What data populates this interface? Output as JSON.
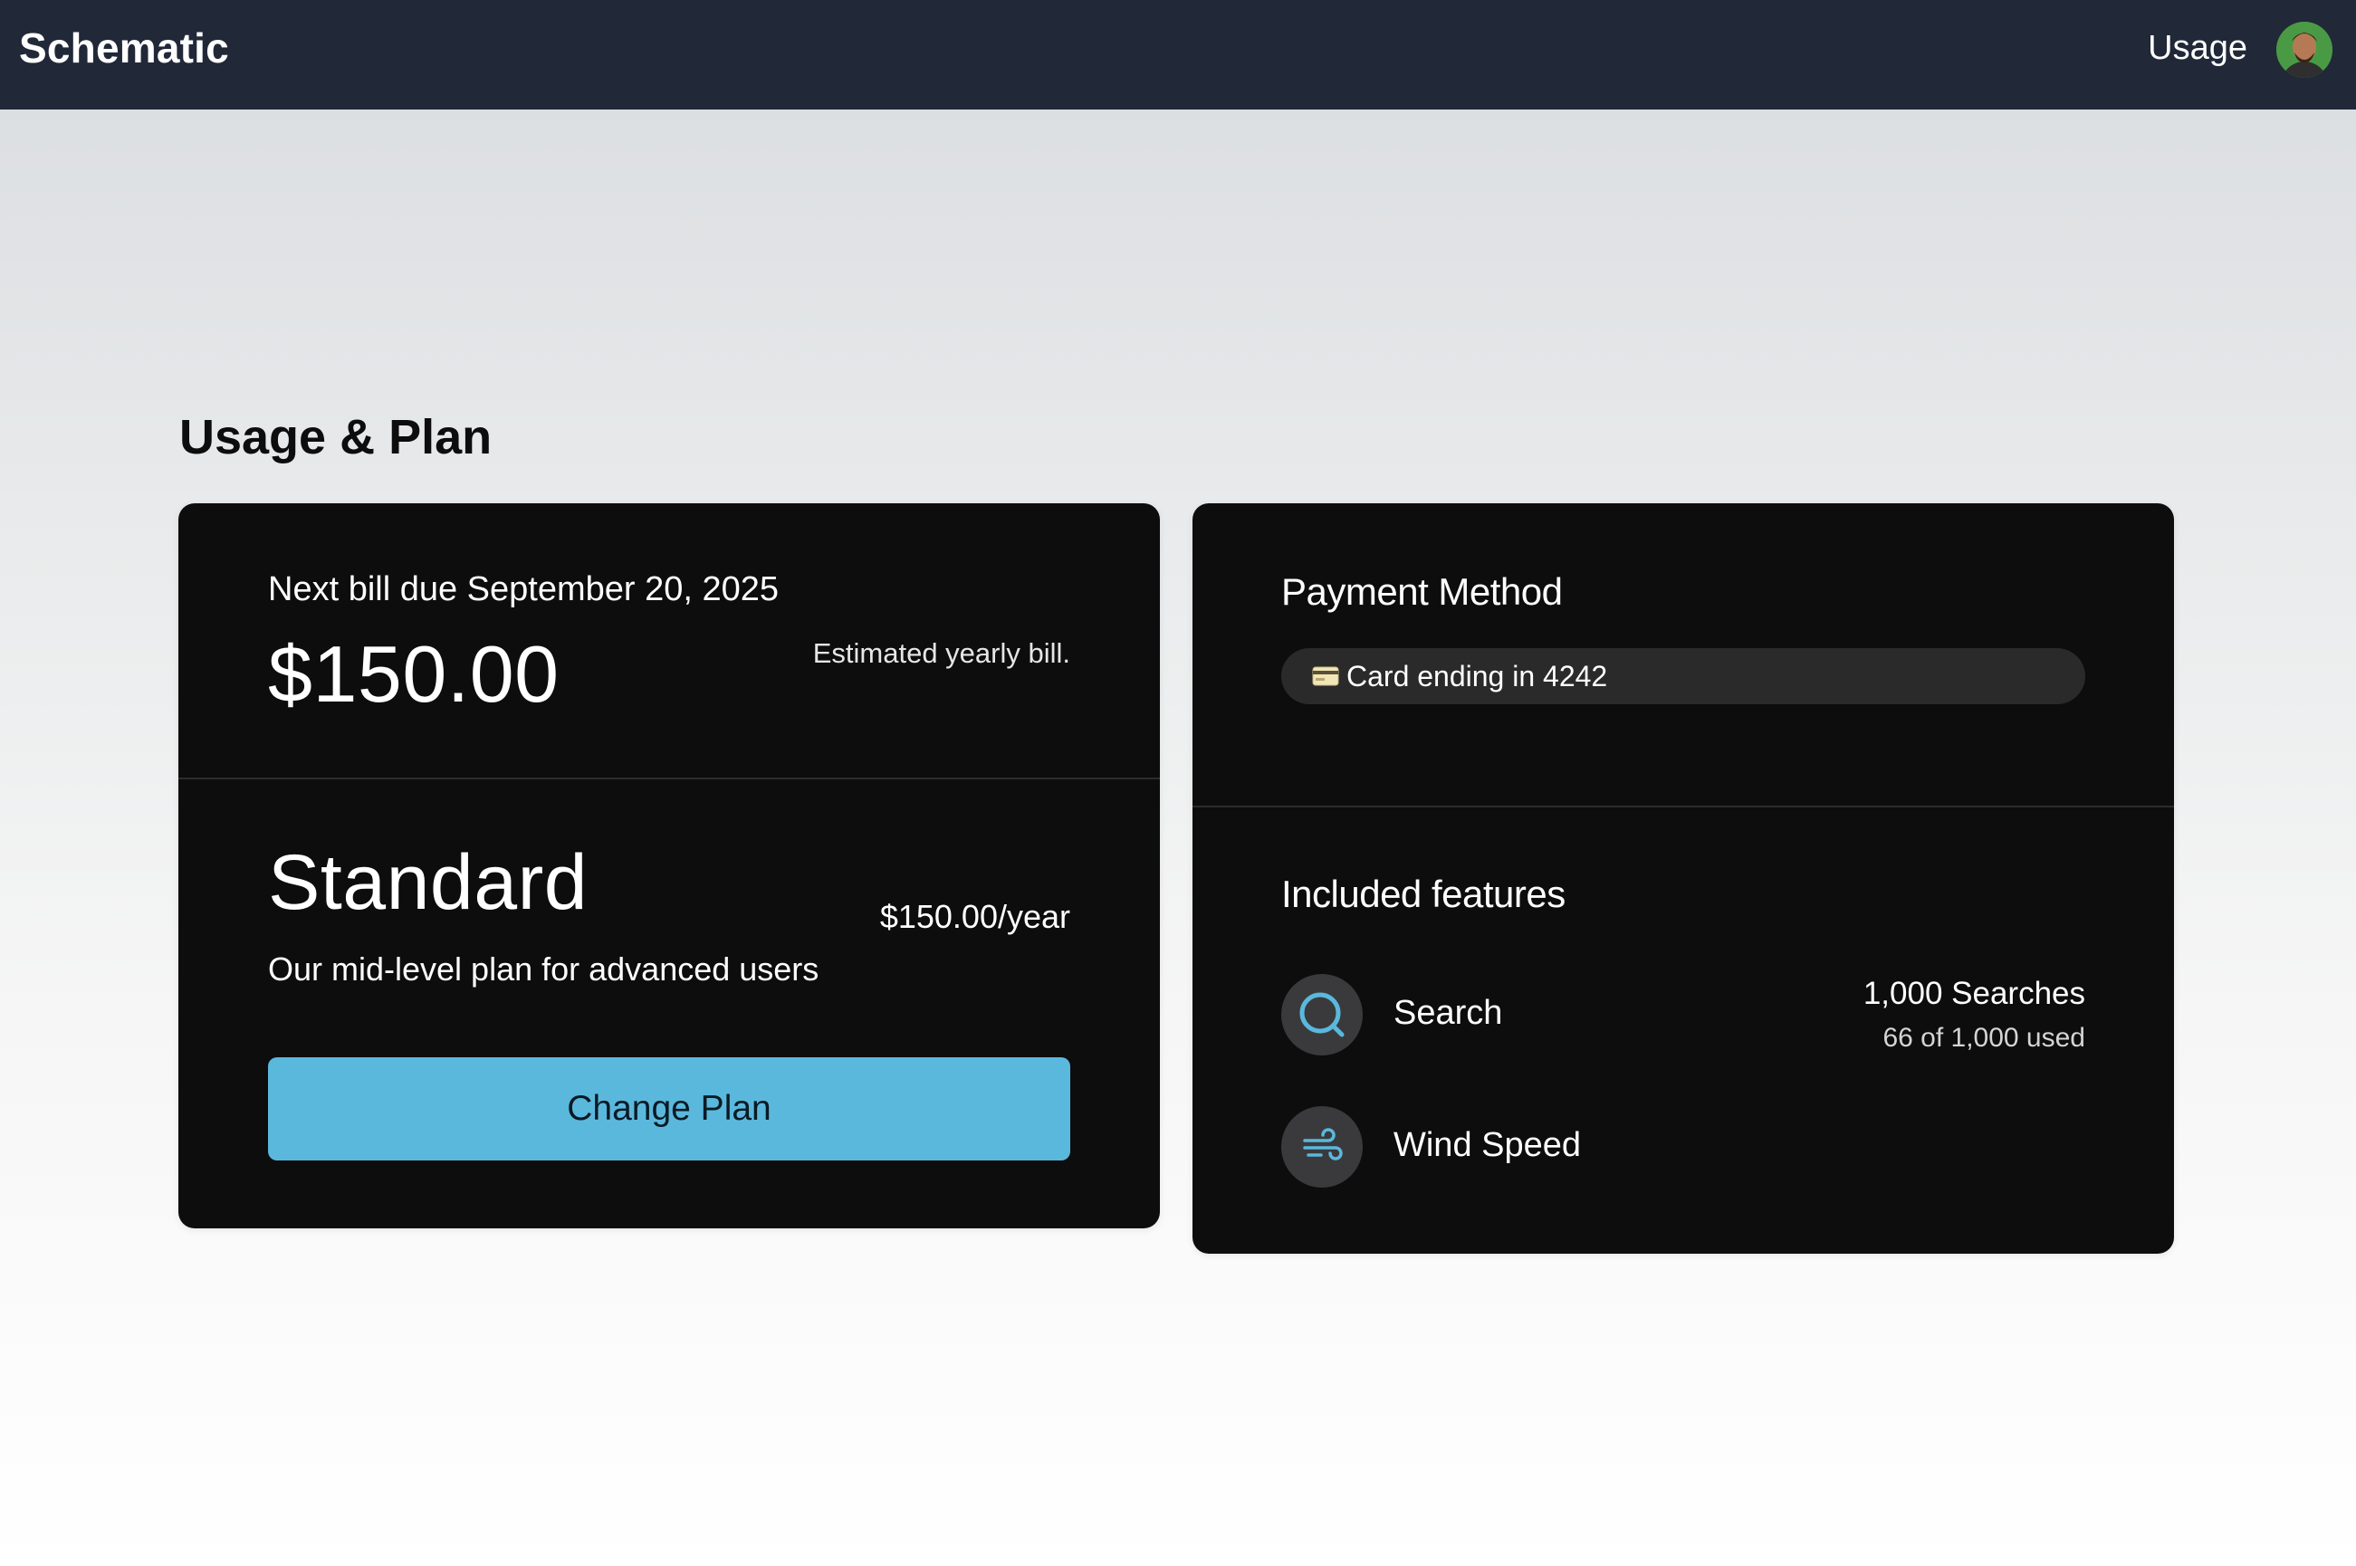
{
  "header": {
    "brand": "Schematic",
    "nav_usage": "Usage"
  },
  "page": {
    "title": "Usage & Plan"
  },
  "billing": {
    "next_bill_due": "Next bill due September 20, 2025",
    "amount": "$150.00",
    "estimate_note": "Estimated yearly bill."
  },
  "plan": {
    "name": "Standard",
    "price": "$150.00/year",
    "description": "Our mid-level plan for advanced users",
    "change_label": "Change Plan"
  },
  "payment": {
    "title": "Payment Method",
    "card_label": "Card ending in 4242"
  },
  "features": {
    "title": "Included features",
    "items": [
      {
        "name": "Search",
        "icon": "search-icon",
        "quantity": "1,000 Searches",
        "usage": "66 of 1,000 used"
      },
      {
        "name": "Wind Speed",
        "icon": "wind-icon"
      }
    ]
  },
  "colors": {
    "header_bg": "#212838",
    "card_bg": "#0d0d0e",
    "accent": "#5bb8dd",
    "icon_accent": "#5bb8dd"
  }
}
